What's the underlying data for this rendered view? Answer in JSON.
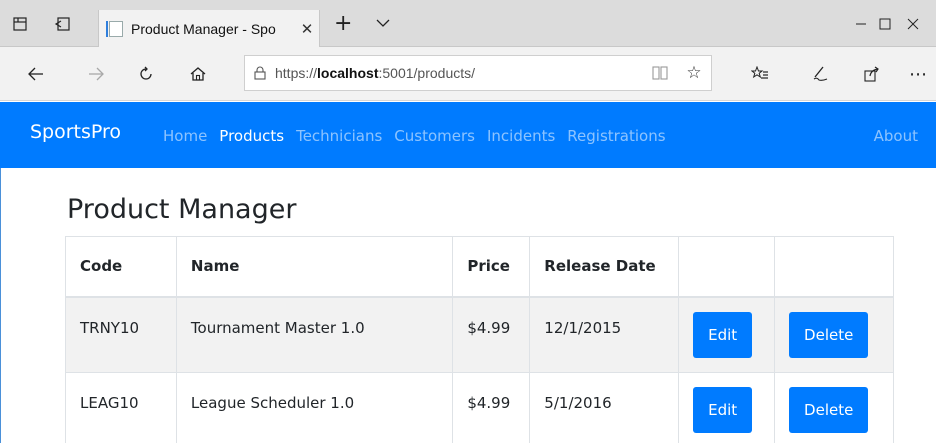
{
  "browser": {
    "tab_title": "Product Manager - Spo",
    "url_prefix": "https://",
    "url_host": "localhost",
    "url_suffix": ":5001/products/"
  },
  "site": {
    "brand": "SportsPro",
    "nav": [
      "Home",
      "Products",
      "Technicians",
      "Customers",
      "Incidents",
      "Registrations"
    ],
    "active_nav": "Products",
    "about": "About"
  },
  "page": {
    "title": "Product Manager",
    "columns": [
      "Code",
      "Name",
      "Price",
      "Release Date",
      "",
      ""
    ],
    "rows": [
      {
        "code": "TRNY10",
        "name": "Tournament Master 1.0",
        "price": "$4.99",
        "release_date": "12/1/2015",
        "edit": "Edit",
        "delete": "Delete"
      },
      {
        "code": "LEAG10",
        "name": "League Scheduler 1.0",
        "price": "$4.99",
        "release_date": "5/1/2016",
        "edit": "Edit",
        "delete": "Delete"
      }
    ]
  },
  "colors": {
    "primary": "#007bff",
    "stripe": "#f2f2f2"
  }
}
